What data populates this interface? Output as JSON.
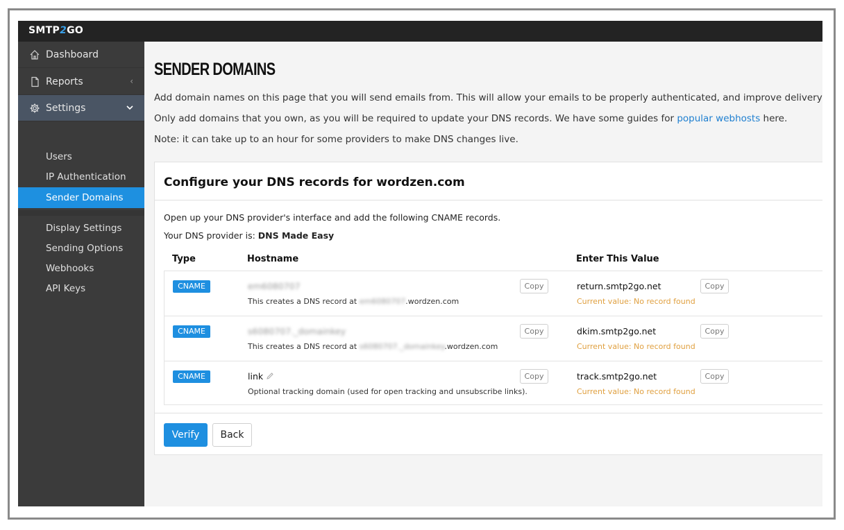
{
  "brand": {
    "logo_left": "SMTP",
    "logo_mid": "2",
    "logo_right": "GO"
  },
  "sidebar": {
    "items": [
      {
        "label": "Dashboard",
        "icon": "home-icon"
      },
      {
        "label": "Reports",
        "icon": "document-icon"
      },
      {
        "label": "Settings",
        "icon": "gear-icon"
      }
    ],
    "settings_sub": [
      "Users",
      "IP Authentication",
      "Sender Domains"
    ],
    "settings_sub2": [
      "Display Settings",
      "Sending Options",
      "Webhooks",
      "API Keys"
    ],
    "active": "Sender Domains"
  },
  "page": {
    "title": "SENDER DOMAINS",
    "intro1": "Add domain names on this page that you will send emails from. This will allow your emails to be properly authenticated, and improve delivery rates.",
    "intro2_pre": "Only add domains that you own, as you will be required to update your DNS records. We have some guides for ",
    "intro2_link": "popular webhosts",
    "intro2_post": " here.",
    "intro3": "Note: it can take up to an hour for some providers to make DNS changes live."
  },
  "card": {
    "title": "Configure your DNS records for wordzen.com",
    "desc1": "Open up your DNS provider's interface and add the following CNAME records.",
    "desc2_label": "Your DNS provider is: ",
    "desc2_value": "DNS Made Easy",
    "columns": [
      "Type",
      "Hostname",
      "Enter This Value"
    ],
    "rows": [
      {
        "type": "CNAME",
        "hostname": "em6080707",
        "note_pre": "This creates a DNS record at ",
        "note_blur": "em6080707",
        "note_post": ".wordzen.com",
        "copy": "Copy",
        "value": "return.smtp2go.net",
        "current": "Current value: No record found"
      },
      {
        "type": "CNAME",
        "hostname": "s6080707._domainkey",
        "note_pre": "This creates a DNS record at ",
        "note_blur": "s6080707._domainkey",
        "note_post": ".wordzen.com",
        "copy": "Copy",
        "value": "dkim.smtp2go.net",
        "current": "Current value: No record found"
      },
      {
        "type": "CNAME",
        "hostname": "link",
        "note": "Optional tracking domain (used for open tracking and unsubscribe links).",
        "copy": "Copy",
        "value": "track.smtp2go.net",
        "current": "Current value: No record found"
      }
    ],
    "verify": "Verify",
    "back": "Back"
  },
  "colors": {
    "accent": "#1e8fe0",
    "sidebar": "#3b3b3b",
    "warning": "#e0a040"
  }
}
